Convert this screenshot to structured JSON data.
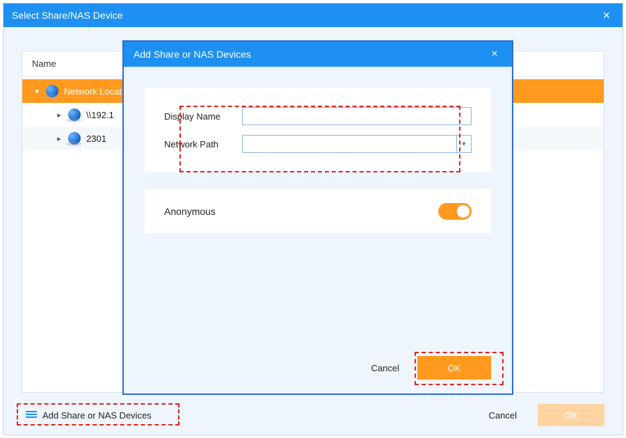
{
  "outer": {
    "title": "Select Share/NAS Device",
    "close_glyph": "×",
    "tree": {
      "header_name": "Name",
      "root": {
        "label": "Network Locations",
        "expanded": true
      },
      "children": [
        {
          "label": "\\\\192.1",
          "expanded": false
        },
        {
          "label": "2301",
          "expanded": false
        }
      ]
    },
    "footer": {
      "add_link": "Add Share or NAS Devices",
      "cancel": "Cancel",
      "ok": "OK"
    }
  },
  "inner": {
    "title": "Add Share or NAS Devices",
    "close_glyph": "×",
    "form": {
      "display_name_label": "Display Name",
      "display_name_value": "",
      "network_path_label": "Network Path",
      "network_path_value": "",
      "dropdown_glyph": "▾"
    },
    "anonymous": {
      "label": "Anonymous",
      "on": true
    },
    "footer": {
      "cancel": "Cancel",
      "ok": "OK"
    }
  }
}
